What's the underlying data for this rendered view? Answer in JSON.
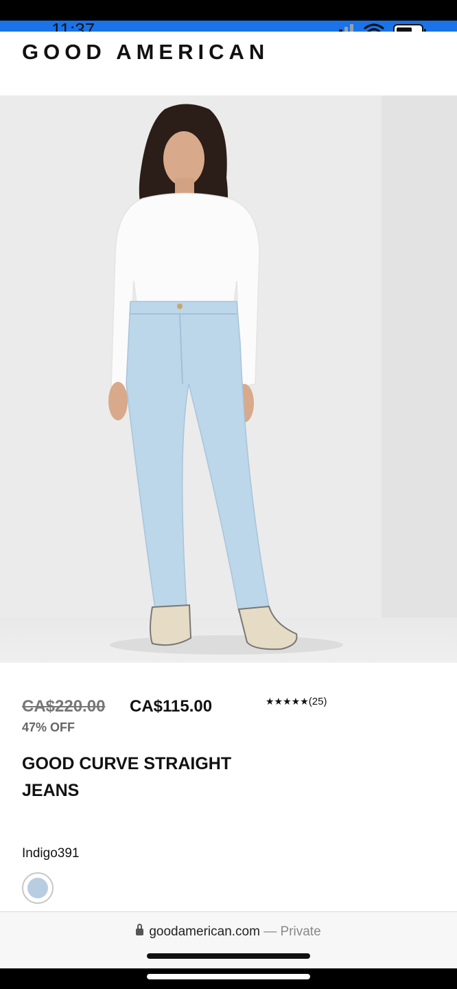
{
  "status_bar": {
    "time": "11:37",
    "icons": [
      "cellular-signal-icon",
      "wifi-icon",
      "battery-icon"
    ]
  },
  "header": {
    "brand": "GOOD AMERICAN"
  },
  "product": {
    "image_icon": "product-photo",
    "price_original": "CA$220.00",
    "price_sale": "CA$115.00",
    "discount": "47% OFF",
    "rating_stars": "★★★★★",
    "rating_count": "(25)",
    "rating_value": 5,
    "title": "GOOD CURVE STRAIGHT JEANS",
    "color_label": "Indigo391",
    "swatch_color": "#b9cde0"
  },
  "browser": {
    "domain": "goodamerican.com",
    "separator": "—",
    "mode": "Private"
  },
  "colors": {
    "accent_blue": "#1a73e8",
    "sale_gray": "#777777"
  }
}
